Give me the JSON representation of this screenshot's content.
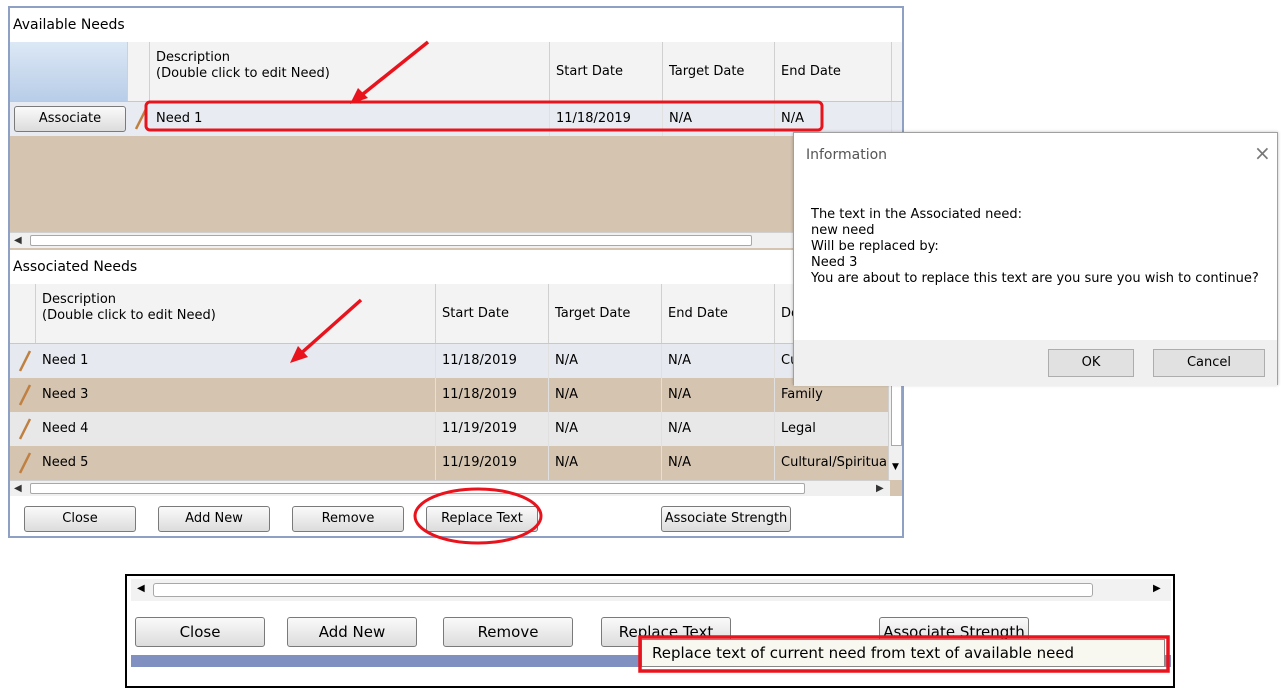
{
  "available": {
    "title": "Available Needs",
    "headers": {
      "description": "Description",
      "description_hint": "(Double click to edit Need)",
      "start": "Start Date",
      "target": "Target Date",
      "end": "End Date"
    },
    "associate_label": "Associate",
    "row": {
      "description": "Need 1",
      "start": "11/18/2019",
      "target": "N/A",
      "end": "N/A"
    }
  },
  "associated": {
    "title": "Associated Needs",
    "headers": {
      "description": "Description",
      "description_hint": "(Double click to edit Need)",
      "start": "Start Date",
      "target": "Target Date",
      "end": "End Date",
      "domain_partial": "Do"
    },
    "rows": [
      {
        "description": "Need 1",
        "start": "11/18/2019",
        "target": "N/A",
        "end": "N/A",
        "domain": "Cu"
      },
      {
        "description": "Need 3",
        "start": "11/18/2019",
        "target": "N/A",
        "end": "N/A",
        "domain": "Family"
      },
      {
        "description": "Need 4",
        "start": "11/19/2019",
        "target": "N/A",
        "end": "N/A",
        "domain": "Legal"
      },
      {
        "description": "Need 5",
        "start": "11/19/2019",
        "target": "N/A",
        "end": "N/A",
        "domain": "Cultural/Spiritua"
      }
    ]
  },
  "buttons": {
    "close": "Close",
    "add_new": "Add New",
    "remove": "Remove",
    "replace_text": "Replace Text",
    "associate_strength": "Associate Strength"
  },
  "dialog": {
    "title": "Information",
    "lines": [
      "The text in the Associated need:",
      "new need",
      "Will be replaced by:",
      "Need 3",
      "You are about to replace this text are you sure you wish to continue?"
    ],
    "ok": "OK",
    "cancel": "Cancel"
  },
  "tooltip": {
    "text": "Replace text of current need from text of available need"
  },
  "colors": {
    "annotation_red": "#e8131c",
    "row_tan": "#d4c4b0",
    "window_border": "#8ea0c3"
  }
}
